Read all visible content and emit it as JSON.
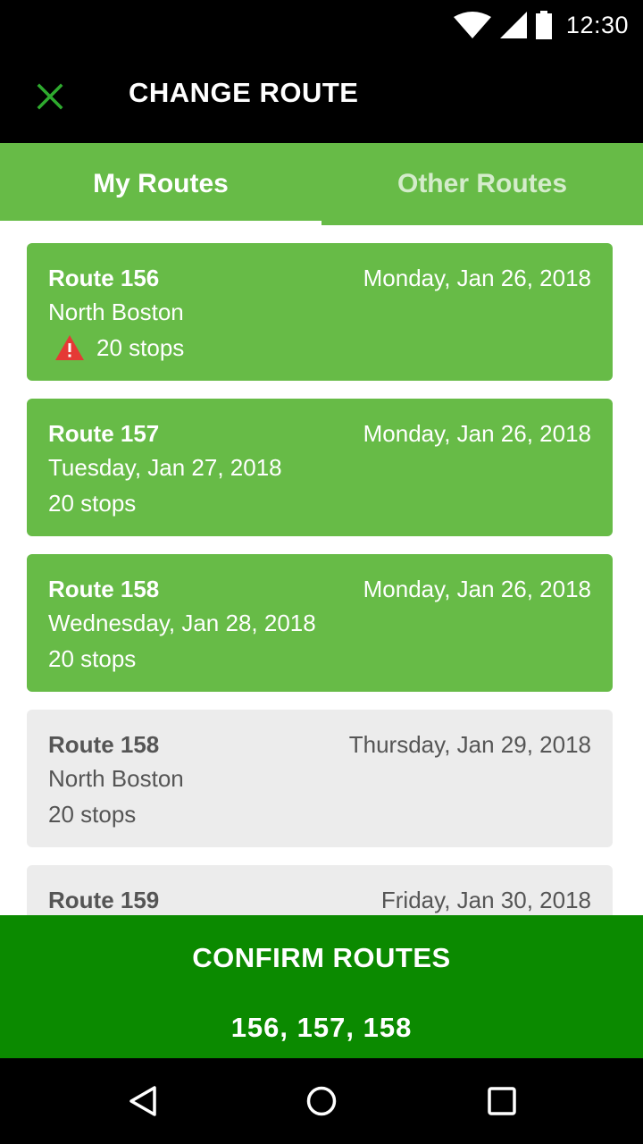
{
  "status_bar": {
    "time": "12:30",
    "icons": [
      "wifi-icon",
      "signal-icon",
      "battery-icon"
    ]
  },
  "app_bar": {
    "title": "CHANGE ROUTE",
    "close_icon": "close-icon",
    "close_color": "#2eaa2e"
  },
  "tabs": [
    {
      "label": "My Routes",
      "active": true
    },
    {
      "label": "Other Routes",
      "active": false
    }
  ],
  "routes": [
    {
      "title": "Route 156",
      "date": "Monday, Jan 26, 2018",
      "line2": "North Boston",
      "stops": "20 stops",
      "warning": true,
      "selected": true
    },
    {
      "title": "Route 157",
      "date": "Monday, Jan 26, 2018",
      "line2": "Tuesday, Jan 27, 2018",
      "stops": "20 stops",
      "warning": false,
      "selected": true
    },
    {
      "title": "Route 158",
      "date": "Monday, Jan 26, 2018",
      "line2": "Wednesday, Jan 28, 2018",
      "stops": "20 stops",
      "warning": false,
      "selected": true
    },
    {
      "title": "Route 158",
      "date": "Thursday, Jan 29, 2018",
      "line2": "North Boston",
      "stops": "20 stops",
      "warning": false,
      "selected": false
    },
    {
      "title": "Route 159",
      "date": "Friday, Jan 30, 2018",
      "line2": "",
      "stops": "",
      "warning": false,
      "selected": false
    }
  ],
  "confirm": {
    "label": "CONFIRM ROUTES",
    "routes": "156, 157, 158"
  },
  "nav_bar": {
    "icons": [
      "back-icon",
      "home-icon",
      "recents-icon"
    ]
  },
  "colors": {
    "accent": "#67bb47",
    "confirm": "#0b8a00",
    "warning": "#e53935",
    "unselected_card": "#ececec"
  }
}
